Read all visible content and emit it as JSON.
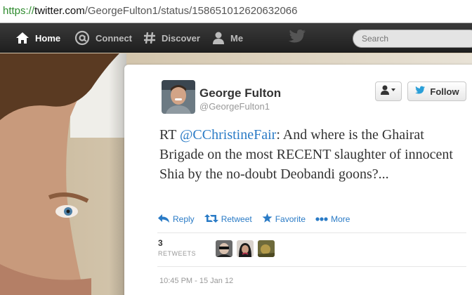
{
  "browser": {
    "url_protocol": "https://",
    "url_host": "twitter.com",
    "url_path": "/GeorgeFulton1/status/158651012620632066"
  },
  "nav": {
    "home": "Home",
    "connect": "Connect",
    "discover": "Discover",
    "me": "Me",
    "search_placeholder": "Search"
  },
  "tweet": {
    "fullname": "George Fulton",
    "screenname": "@GeorgeFulton1",
    "follow_label": "Follow",
    "text_prefix": "RT ",
    "mention": "@CChristineFair",
    "text_body": ": And where is the Ghairat Brigade on the most RECENT slaughter of innocent Shia by the no-doubt Deobandi goons?...",
    "actions": {
      "reply": "Reply",
      "retweet": "Retweet",
      "favorite": "Favorite",
      "more": "More"
    },
    "retweet_count": "3",
    "retweet_label": "RETWEETS",
    "timestamp": "10:45 PM - 15 Jan 12"
  },
  "colors": {
    "link": "#2a7bc6",
    "topbar": "#2b2b2b",
    "secure_green": "#2e8b2e"
  },
  "icons": [
    "home-icon",
    "connect-at-icon",
    "discover-hash-icon",
    "me-person-icon",
    "twitter-bird-icon",
    "user-actions-icon",
    "reply-icon",
    "retweet-icon",
    "favorite-star-icon",
    "more-dots-icon"
  ]
}
